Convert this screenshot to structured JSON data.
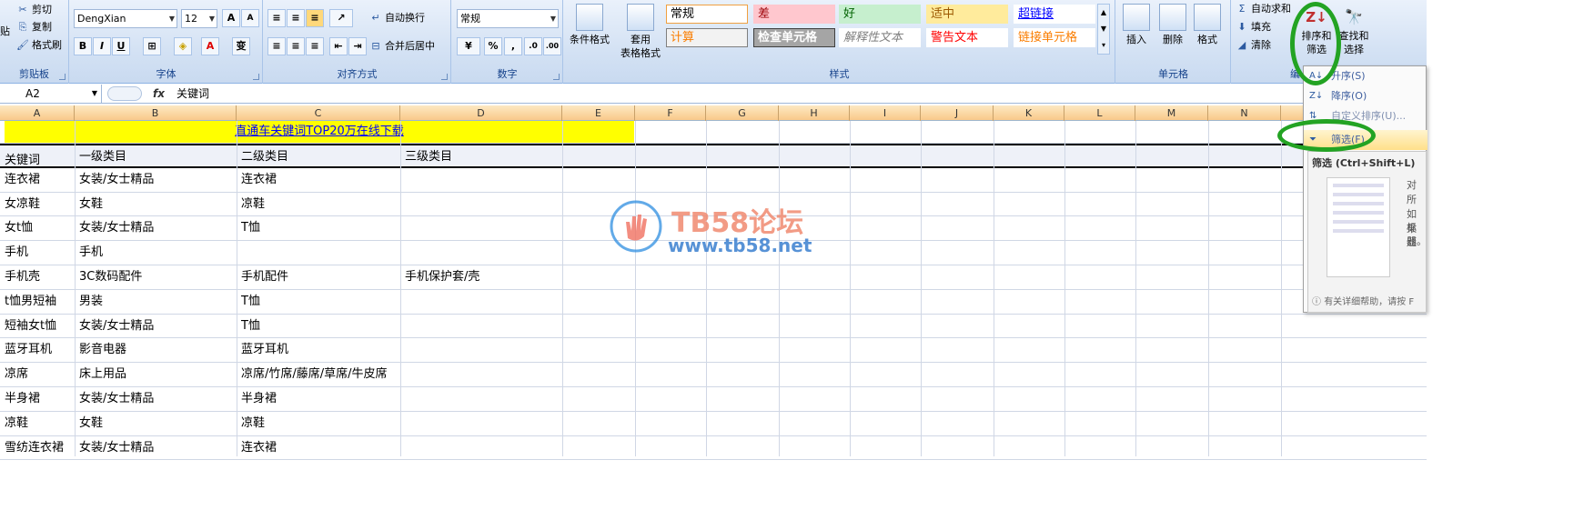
{
  "ribbon": {
    "clipboard": {
      "label": "剪贴板",
      "cut": "剪切",
      "copy": "复制",
      "format_painter": "格式刷",
      "paste": "贴"
    },
    "font": {
      "label": "字体",
      "family": "DengXian",
      "size": "12",
      "grow": "A",
      "shrink": "A",
      "bold": "B",
      "italic": "I",
      "underline": "U",
      "pinyin": "变"
    },
    "alignment": {
      "label": "对齐方式",
      "wrap": "自动换行",
      "merge": "合并后居中"
    },
    "number": {
      "label": "数字",
      "format": "常规",
      "percent": "%",
      "comma": ",",
      "inc_dec": ".0",
      "dec_dec": ".00"
    },
    "styles": {
      "label": "样式",
      "cond_format": "条件格式",
      "table_format_line1": "套用",
      "table_format_line2": "表格格式",
      "cells": [
        {
          "text": "常规",
          "bg": "#ffffff",
          "fg": "#000000",
          "border": "#f0a040"
        },
        {
          "text": "差",
          "bg": "#ffc7ce",
          "fg": "#9c0006",
          "border": "#ffc7ce"
        },
        {
          "text": "好",
          "bg": "#c6efce",
          "fg": "#006100",
          "border": "#c6efce"
        },
        {
          "text": "适中",
          "bg": "#ffeb9c",
          "fg": "#9c5700",
          "border": "#ffeb9c"
        },
        {
          "text": "超链接",
          "bg": "#ffffff",
          "fg": "#0000ff",
          "border": "#ffffff"
        },
        {
          "text": "计算",
          "bg": "#f2f2f2",
          "fg": "#fa7d00",
          "border": "#7f7f7f"
        },
        {
          "text": "检查单元格",
          "bg": "#a5a5a5",
          "fg": "#ffffff",
          "border": "#3f3f3f"
        },
        {
          "text": "解释性文本",
          "bg": "#ffffff",
          "fg": "#7f7f7f",
          "border": "#ffffff"
        },
        {
          "text": "警告文本",
          "bg": "#ffffff",
          "fg": "#ff0000",
          "border": "#ffffff"
        },
        {
          "text": "链接单元格",
          "bg": "#ffffff",
          "fg": "#fa7d00",
          "border": "#ffffff"
        }
      ]
    },
    "cells_group": {
      "label": "单元格",
      "insert": "插入",
      "delete": "删除",
      "format": "格式"
    },
    "editing": {
      "label": "编",
      "autosum": "自动求和",
      "fill": "填充",
      "clear": "清除",
      "sort_filter_1": "排序和",
      "sort_filter_2": "筛选",
      "find_1": "查找和",
      "find_2": "选择"
    }
  },
  "formula_bar": {
    "cell_ref": "A2",
    "fx": "fx",
    "value": "关键词"
  },
  "columns": [
    "A",
    "B",
    "C",
    "D",
    "E",
    "F",
    "G",
    "H",
    "I",
    "J",
    "K",
    "L",
    "M",
    "N"
  ],
  "banner": "直通车关键词TOP20万在线下载",
  "header_row": [
    "关键词",
    "一级类目",
    "二级类目",
    "三级类目"
  ],
  "rows": [
    [
      "连衣裙",
      "女装/女士精品",
      "连衣裙",
      ""
    ],
    [
      "女凉鞋",
      "女鞋",
      "凉鞋",
      ""
    ],
    [
      "女t恤",
      "女装/女士精品",
      "T恤",
      ""
    ],
    [
      "手机",
      "手机",
      "",
      ""
    ],
    [
      "手机壳",
      "3C数码配件",
      "手机配件",
      "手机保护套/壳"
    ],
    [
      "t恤男短袖",
      "男装",
      "T恤",
      ""
    ],
    [
      "短袖女t恤",
      "女装/女士精品",
      "T恤",
      ""
    ],
    [
      "蓝牙耳机",
      "影音电器",
      "蓝牙耳机",
      ""
    ],
    [
      "凉席",
      "床上用品",
      "凉席/竹席/藤席/草席/牛皮席",
      ""
    ],
    [
      "半身裙",
      "女装/女士精品",
      "半身裙",
      ""
    ],
    [
      "凉鞋",
      "女鞋",
      "凉鞋",
      ""
    ],
    [
      "雪纺连衣裙",
      "女装/女士精品",
      "连衣裙",
      ""
    ]
  ],
  "menu": {
    "asc": "升序(S)",
    "desc": "降序(O)",
    "custom": "自定义排序(U)...",
    "filter": "筛选(F)",
    "tooltip_title": "筛选 (Ctrl+Shift+L)",
    "tooltip_side1": "对所",
    "tooltip_side2": "如果",
    "tooltip_side3": "标题",
    "tooltip_side4": "器。",
    "tooltip_help": "有关详细帮助，请按 F"
  },
  "watermark": {
    "title": "TB58论坛",
    "url": "www.tb58.net"
  },
  "colors": {
    "accent_green": "#23a323",
    "banner_yellow": "#ffff00",
    "link_blue": "#0000ff"
  }
}
